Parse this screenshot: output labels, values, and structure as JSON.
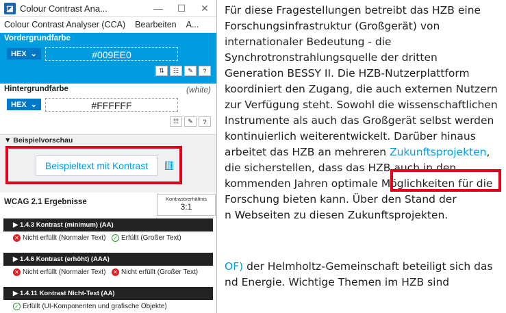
{
  "webpage": {
    "lines": [
      "Für diese Fragestellungen betreibt das HZB eine",
      "Forschungsinfrastruktur (Großgerät) von",
      "internationaler Bedeutung - die",
      "Synchrotronstrahlungsquelle der dritten",
      "Generation BESSY II. Die HZB-Nutzerplattform",
      "koordiniert den Zugang, die auch externen Nutzern",
      "zur Verfügung steht. Sowohl die wissenschaftlichen",
      "Instrumente als auch das Großgerät selbst werden",
      "kontinuierlich weiterentwickelt. Darüber hinaus"
    ],
    "link_line_before": "arbeitet das HZB an mehreren ",
    "link_text": "Zukunftsprojekten",
    "link_line_after": ",",
    "lines_after": [
      "die sicherstellen, dass das HZB auch in den",
      "kommenden Jahren optimale Möglichkeiten für die",
      "Forschung bieten kann. Über den Stand der",
      "n Webseiten zu diesen Zukunftsprojekten."
    ],
    "bottom_link": "OF)",
    "bottom_line": " der Helmholtz-Gemeinschaft beteiligt sich das",
    "last_line": "nd Energie. Wichtige Themen im HZB sind"
  },
  "cca": {
    "title": "Colour Contrast Ana...",
    "menu": [
      "Colour Contrast Analyser (CCA)",
      "Bearbeiten",
      "A..."
    ],
    "foreground": {
      "label": "Vordergrundfarbe",
      "format": "HEX",
      "value": "#009EE0",
      "color": "#009ee0"
    },
    "background": {
      "label": "Hintergrundfarbe",
      "name": "(white)",
      "format": "HEX",
      "value": "#FFFFFF"
    },
    "preview": {
      "label": "▼ Beispielvorschau",
      "sample_text": "Beispieltext mit Kontrast"
    },
    "wcag": {
      "title": "WCAG 2.1 Ergebnisse",
      "ratio_label": "Kontrastverhältnis",
      "ratio": "3:1",
      "criteria": [
        {
          "title": "▶ 1.4.3 Kontrast (minimum) (AA)",
          "r1": "Nicht erfüllt (Normaler Text)",
          "r1_status": "fail",
          "r2": "Erfüllt (Großer Text)",
          "r2_status": "pass"
        },
        {
          "title": "▶ 1.4.6 Kontrast (erhöht) (AAA)",
          "r1": "Nicht erfüllt (Normaler Text)",
          "r1_status": "fail",
          "r2": "Nicht erfüllt (Großer Text)",
          "r2_status": "fail"
        },
        {
          "title": "▶ 1.4.11 Kontrast Nicht-Text (AA)",
          "r1": "Erfüllt (UI-Komponenten und grafische Objekte)",
          "r1_status": "pass"
        }
      ]
    }
  },
  "colors": {
    "highlight": "#e3001b",
    "link": "#009ee0"
  }
}
